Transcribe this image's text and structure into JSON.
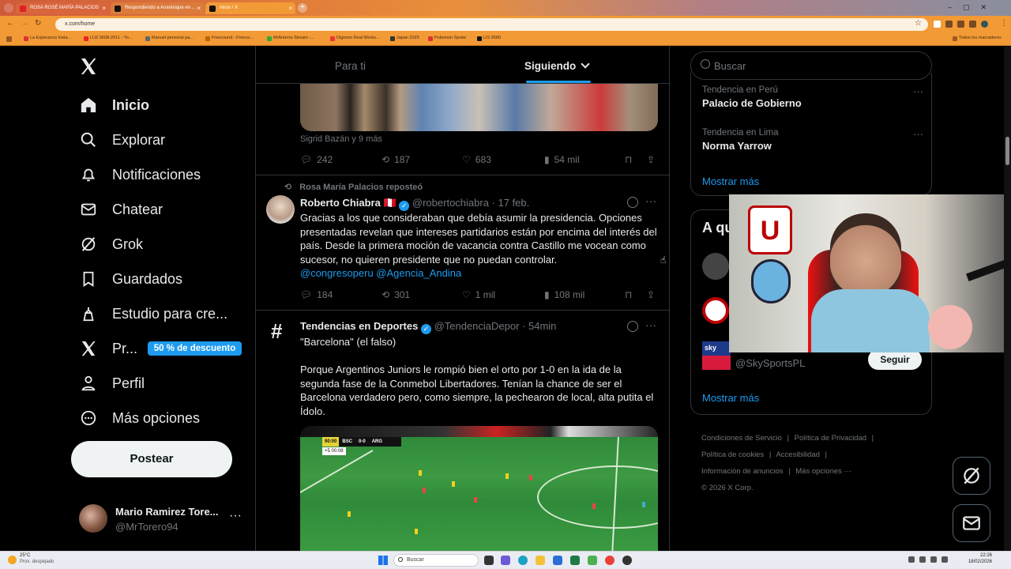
{
  "browser": {
    "tabs": [
      {
        "label": "ROSA ROSÉ MARÍA PALACIOS",
        "color": "#e02020"
      },
      {
        "label": "Respondiendo a Ananisique en ...",
        "color": "#111111"
      },
      {
        "label": "Inicio / X",
        "color": "#111111"
      }
    ],
    "url": "x.com/home",
    "bookmarks": [
      "La Esperanza Inela...",
      "LUZ 9608-2011 - Yo...",
      "Manuel personal pa...",
      "Freecound - Freeco...",
      "MrAnterra Stream -...",
      "Digimon Real Works...",
      "Japan 2025",
      "Pokemon Spoke",
      "LIS 9580"
    ],
    "bookmarks_right": "Todos los marcadores"
  },
  "nav": {
    "items": [
      {
        "label": "Inicio",
        "icon": "home-icon"
      },
      {
        "label": "Explorar",
        "icon": "search-icon"
      },
      {
        "label": "Notificaciones",
        "icon": "bell-icon"
      },
      {
        "label": "Chatear",
        "icon": "mail-icon"
      },
      {
        "label": "Grok",
        "icon": "grok-icon"
      },
      {
        "label": "Guardados",
        "icon": "bookmark-icon"
      },
      {
        "label": "Estudio para cre...",
        "icon": "studio-icon"
      },
      {
        "label": "Pr...",
        "icon": "premium-x-icon"
      },
      {
        "label": "Perfil",
        "icon": "person-icon"
      },
      {
        "label": "Más opciones",
        "icon": "more-circle-icon"
      }
    ],
    "premium_badge": "50 % de descuento",
    "post_button": "Postear",
    "account": {
      "name": "Mario Ramirez Tore...",
      "handle": "@MrTorero94"
    }
  },
  "feed": {
    "tabs": {
      "for_you": "Para ti",
      "following": "Siguiendo"
    },
    "tweet1": {
      "caption": "Sigrid Bazán y 9 más",
      "replies": "242",
      "reposts": "187",
      "likes": "683",
      "views": "54 mil"
    },
    "tweet2": {
      "repost_line": "Rosa María Palacios reposteó",
      "name": "Roberto Chiabra",
      "flag": "🇵🇪",
      "handle": "@robertochiabra",
      "date": "· 17 feb.",
      "text": "Gracias a los que consideraban que debía asumir la presidencia. Opciones presentadas revelan que intereses partidarios están por encima del interés del país. Desde la primera moción de vacancia contra Castillo me vocean como sucesor, no quieren presidente que no puedan controlar.",
      "links": "@congresoperu @Agencia_Andina",
      "replies": "184",
      "reposts": "301",
      "likes": "1 mil",
      "views": "108 mil"
    },
    "tweet3": {
      "name": "Tendencias en Deportes",
      "handle": "@TendenciaDepor",
      "date": "· 54min",
      "line1": "\"Barcelona\" (el falso)",
      "text": "Porque Argentinos Juniors le rompió bien el orto por 1-0 en la ida de la segunda fase de la Conmebol Libertadores. Tenían la chance de ser el Barcelona verdadero pero, como siempre, la pechearon de local, alta putita el Ídolo.",
      "scoreboard": {
        "time": "90:00",
        "home": "BSC",
        "score": "0-0",
        "away": "ARG",
        "added": "+5",
        "added_time": "00:08"
      }
    }
  },
  "sidebar": {
    "search_placeholder": "Buscar",
    "trends": [
      {
        "context": "Tendencia en Perú",
        "name": "Palacio de Gobierno"
      },
      {
        "context": "Tendencia en Lima",
        "name": "Norma Yarrow"
      }
    ],
    "show_more": "Mostrar más",
    "who_to_follow_title": "A qu",
    "follow_handle": "@SkySportsPL",
    "follow_button": "Seguir",
    "show_more2": "Mostrar más",
    "footer": [
      "Condiciones de Servicio",
      "Política de Privacidad",
      "Política de cookies",
      "Accesibilidad",
      "Información de anuncios",
      "Más opciones ···"
    ],
    "copyright": "© 2026 X Corp."
  },
  "taskbar": {
    "weather": "25°C",
    "weather_desc": "Prox. despejado",
    "search": "Buscar",
    "time": "22:26",
    "date": "18/02/2026"
  }
}
